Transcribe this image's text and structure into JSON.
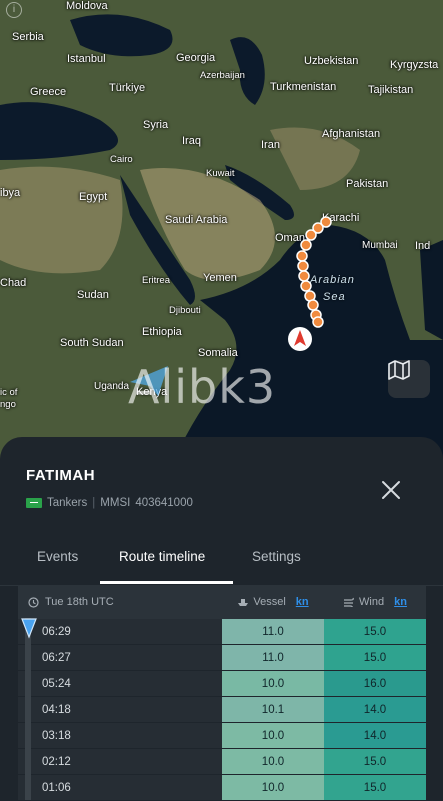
{
  "map": {
    "labels": {
      "moldova": "Moldova",
      "serbia": "Serbia",
      "istanbul": "Istanbul",
      "greece": "Greece",
      "turkiye": "Türkiye",
      "georgia": "Georgia",
      "azerbaijan": "Azerbaijan",
      "uzbekistan": "Uzbekistan",
      "kyrgyzstan": "Kyrgyzsta",
      "turkmenistan": "Turkmenistan",
      "tajikistan": "Tajikistan",
      "syria": "Syria",
      "iraq": "Iraq",
      "iran": "Iran",
      "afghanistan": "Afghanistan",
      "cairo": "Cairo",
      "kuwait": "Kuwait",
      "pakistan": "Pakistan",
      "libya": "ibya",
      "egypt": "Egypt",
      "saudi": "Saudi Arabia",
      "karachi": "Karachi",
      "oman": "Oman",
      "mumbai": "Mumbai",
      "india": "Ind",
      "chad": "Chad",
      "eritrea": "Eritrea",
      "yemen": "Yemen",
      "sudan": "Sudan",
      "djibouti": "Djibouti",
      "ethiopia": "Ethiopia",
      "south_sudan": "South Sudan",
      "somalia": "Somalia",
      "uganda": "Uganda",
      "kenya": "Kenya",
      "congo1": "ic of",
      "congo2": "ngo"
    },
    "sea": {
      "line1": "Arabian",
      "line2": "Sea"
    },
    "watermark": "Alibk3",
    "info_glyph": "i"
  },
  "vessel": {
    "name": "FATIMAH",
    "type": "Tankers",
    "separator": "|",
    "mmsi_label": "MMSI",
    "mmsi": "403641000"
  },
  "tabs": [
    {
      "label": "Events"
    },
    {
      "label": "Route timeline"
    },
    {
      "label": "Settings"
    }
  ],
  "table": {
    "date_header": "Tue 18th UTC",
    "vessel_header": "Vessel",
    "wind_header": "Wind",
    "unit": "kn",
    "rows": [
      {
        "time": "06:29",
        "vessel": "11.0",
        "wind": "15.0"
      },
      {
        "time": "06:27",
        "vessel": "11.0",
        "wind": "15.0"
      },
      {
        "time": "05:24",
        "vessel": "10.0",
        "wind": "16.0"
      },
      {
        "time": "04:18",
        "vessel": "10.1",
        "wind": "14.0"
      },
      {
        "time": "03:18",
        "vessel": "10.0",
        "wind": "14.0"
      },
      {
        "time": "02:12",
        "vessel": "10.0",
        "wind": "15.0"
      },
      {
        "time": "01:06",
        "vessel": "10.0",
        "wind": "15.0"
      }
    ]
  },
  "colors": {
    "route": "#e8894a",
    "vessel_cell": [
      "#7fb5aa",
      "#7fb5aa",
      "#79b9a4",
      "#7eb6a8",
      "#7dbaa4",
      "#7dbaa4",
      "#7dbaa4"
    ],
    "wind_cell": [
      "#2fa38f",
      "#2fa38f",
      "#2a9a8e",
      "#2a9b92",
      "#2a9b92",
      "#32a48f",
      "#32a48f"
    ]
  }
}
